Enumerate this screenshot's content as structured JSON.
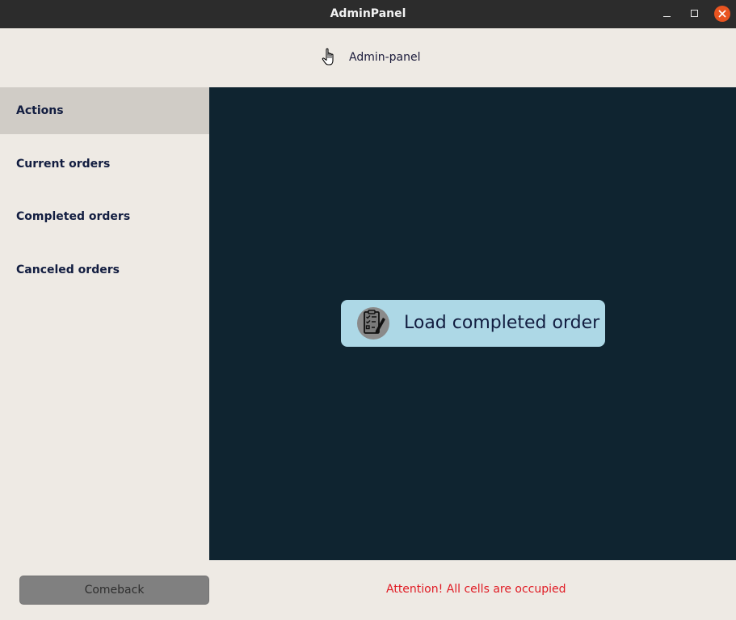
{
  "window": {
    "title": "AdminPanel"
  },
  "header": {
    "title": "Admin-panel",
    "icon": "hand-pointer-icon"
  },
  "sidebar": {
    "items": [
      {
        "label": "Actions",
        "active": true
      },
      {
        "label": "Current orders",
        "active": false
      },
      {
        "label": "Completed orders",
        "active": false
      },
      {
        "label": "Canceled orders",
        "active": false
      }
    ]
  },
  "main": {
    "load_button": {
      "label": "Load completed order",
      "icon": "checklist-icon"
    }
  },
  "footer": {
    "comeback_label": "Comeback",
    "status_message": "Attention! All cells are occupied"
  },
  "colors": {
    "titlebar": "#2c2c2c",
    "panel_bg": "#eeeae4",
    "main_bg": "#0f2430",
    "button_bg": "#add8e6",
    "active_item": "#d0ccc6",
    "warning_text": "#e01b24",
    "close_button": "#e95420"
  }
}
